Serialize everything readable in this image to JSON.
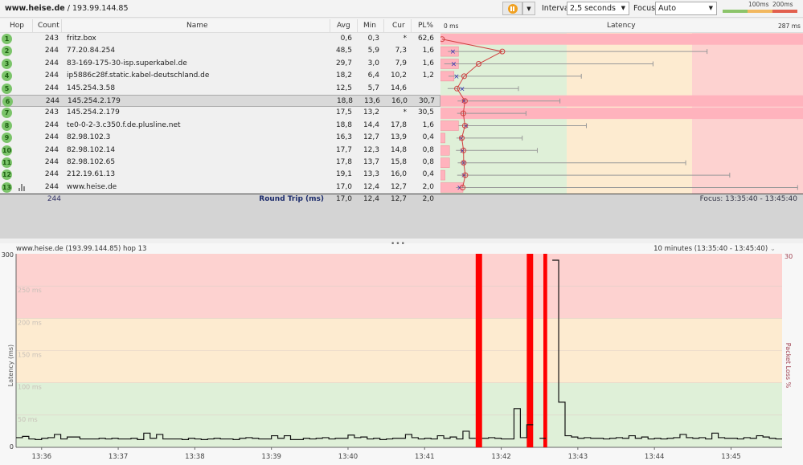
{
  "topbar": {
    "host": "www.heise.de",
    "ip": "193.99.144.85",
    "interval_label": "Interval",
    "interval_value": "2,5 seconds",
    "focus_label": "Focus",
    "focus_value": "Auto",
    "legend_100": "100ms",
    "legend_200": "200ms"
  },
  "colors": {
    "good": "#dff0d8",
    "warn": "#fdebd0",
    "bad": "#fdd2d0",
    "loss": "#ff0000",
    "hop": "#7bc46a"
  },
  "table": {
    "headers": {
      "hop": "Hop",
      "count": "Count",
      "name": "Name",
      "avg": "Avg",
      "min": "Min",
      "cur": "Cur",
      "pl": "PL%",
      "latency": "Latency",
      "lat_min": "0 ms",
      "lat_max": "287 ms"
    },
    "rows": [
      {
        "hop": "1",
        "count": "243",
        "name": "fritz.box",
        "avg": "0,6",
        "min": "0,3",
        "cur": "*",
        "pl": "62,6",
        "max_ms": null
      },
      {
        "hop": "2",
        "count": "244",
        "name": "77.20.84.254",
        "avg": "48,5",
        "min": "5,9",
        "cur": "7,3",
        "pl": "1,6",
        "max_ms": 212
      },
      {
        "hop": "3",
        "count": "244",
        "name": "83-169-175-30-isp.superkabel.de",
        "avg": "29,7",
        "min": "3,0",
        "cur": "7,9",
        "pl": "1,6",
        "max_ms": 169
      },
      {
        "hop": "4",
        "count": "244",
        "name": "ip5886c28f.static.kabel-deutschland.de",
        "avg": "18,2",
        "min": "6,4",
        "cur": "10,2",
        "pl": "1,2",
        "max_ms": 112
      },
      {
        "hop": "5",
        "count": "244",
        "name": "145.254.3.58",
        "avg": "12,5",
        "min": "5,7",
        "cur": "14,6",
        "pl": "",
        "max_ms": 62
      },
      {
        "hop": "6",
        "count": "244",
        "name": "145.254.2.179",
        "avg": "18,8",
        "min": "13,6",
        "cur": "16,0",
        "pl": "30,7",
        "max_ms": 95
      },
      {
        "hop": "7",
        "count": "243",
        "name": "145.254.2.179",
        "avg": "17,5",
        "min": "13,2",
        "cur": "*",
        "pl": "30,5",
        "max_ms": 68
      },
      {
        "hop": "8",
        "count": "244",
        "name": "te0-0-2-3.c350.f.de.plusline.net",
        "avg": "18,8",
        "min": "14,4",
        "cur": "17,8",
        "pl": "1,6",
        "max_ms": 116
      },
      {
        "hop": "9",
        "count": "244",
        "name": "82.98.102.3",
        "avg": "16,3",
        "min": "12,7",
        "cur": "13,9",
        "pl": "0,4",
        "max_ms": 65
      },
      {
        "hop": "10",
        "count": "244",
        "name": "82.98.102.14",
        "avg": "17,7",
        "min": "12,3",
        "cur": "14,8",
        "pl": "0,8",
        "max_ms": 77
      },
      {
        "hop": "11",
        "count": "244",
        "name": "82.98.102.65",
        "avg": "17,8",
        "min": "13,7",
        "cur": "15,8",
        "pl": "0,8",
        "max_ms": 195
      },
      {
        "hop": "12",
        "count": "244",
        "name": "212.19.61.13",
        "avg": "19,1",
        "min": "13,3",
        "cur": "16,0",
        "pl": "0,4",
        "max_ms": 230
      },
      {
        "hop": "13",
        "count": "244",
        "name": "www.heise.de",
        "avg": "17,0",
        "min": "12,4",
        "cur": "12,7",
        "pl": "2,0",
        "max_ms": 284
      }
    ],
    "footer": {
      "count": "244",
      "label": "Round Trip (ms)",
      "avg": "17,0",
      "min": "12,4",
      "cur": "12,7",
      "pl": "2,0",
      "focus": "Focus: 13:35:40 - 13:45:40"
    }
  },
  "chart_data": {
    "type": "line",
    "title": "www.heise.de (193.99.144.85) hop 13",
    "range_label": "10 minutes (13:35:40 - 13:45:40)",
    "ylabel": "Latency (ms)",
    "y2label": "Packet Loss %",
    "y2_max_label": "30",
    "ylim": [
      0,
      300
    ],
    "y_ticks": [
      "0",
      "300"
    ],
    "band_labels": [
      "50 ms",
      "100 ms",
      "150 ms",
      "200 ms",
      "250 ms"
    ],
    "x_start": "13:35:40",
    "interval_s": 5,
    "x_ticks": [
      "13:36",
      "13:37",
      "13:38",
      "13:39",
      "13:40",
      "13:41",
      "13:42",
      "13:43",
      "13:44",
      "13:45"
    ],
    "latency": [
      15,
      17,
      13,
      12,
      14,
      15,
      20,
      13,
      16,
      16,
      13,
      13,
      13,
      14,
      13,
      14,
      13,
      13,
      14,
      12,
      22,
      14,
      20,
      13,
      13,
      13,
      12,
      14,
      13,
      12,
      13,
      14,
      13,
      13,
      12,
      14,
      15,
      14,
      13,
      13,
      18,
      14,
      18,
      12,
      12,
      14,
      13,
      14,
      15,
      13,
      14,
      14,
      19,
      15,
      16,
      13,
      14,
      12,
      13,
      14,
      14,
      20,
      15,
      13,
      14,
      13,
      18,
      14,
      16,
      13,
      25,
      14,
      null,
      14,
      15,
      14,
      13,
      13,
      60,
      15,
      35,
      null,
      14,
      null,
      290,
      70,
      18,
      16,
      14,
      15,
      14,
      14,
      13,
      14,
      15,
      14,
      18,
      14,
      16,
      13,
      14,
      13,
      14,
      15,
      20,
      15,
      14,
      15,
      13,
      22,
      15,
      14,
      14,
      13,
      15,
      14,
      18,
      16,
      14,
      13
    ],
    "loss_events": [
      {
        "start": "13:41:40",
        "end": "13:41:45"
      },
      {
        "start": "13:42:20",
        "end": "13:42:25"
      },
      {
        "start": "13:42:33",
        "end": "13:42:36"
      }
    ]
  }
}
